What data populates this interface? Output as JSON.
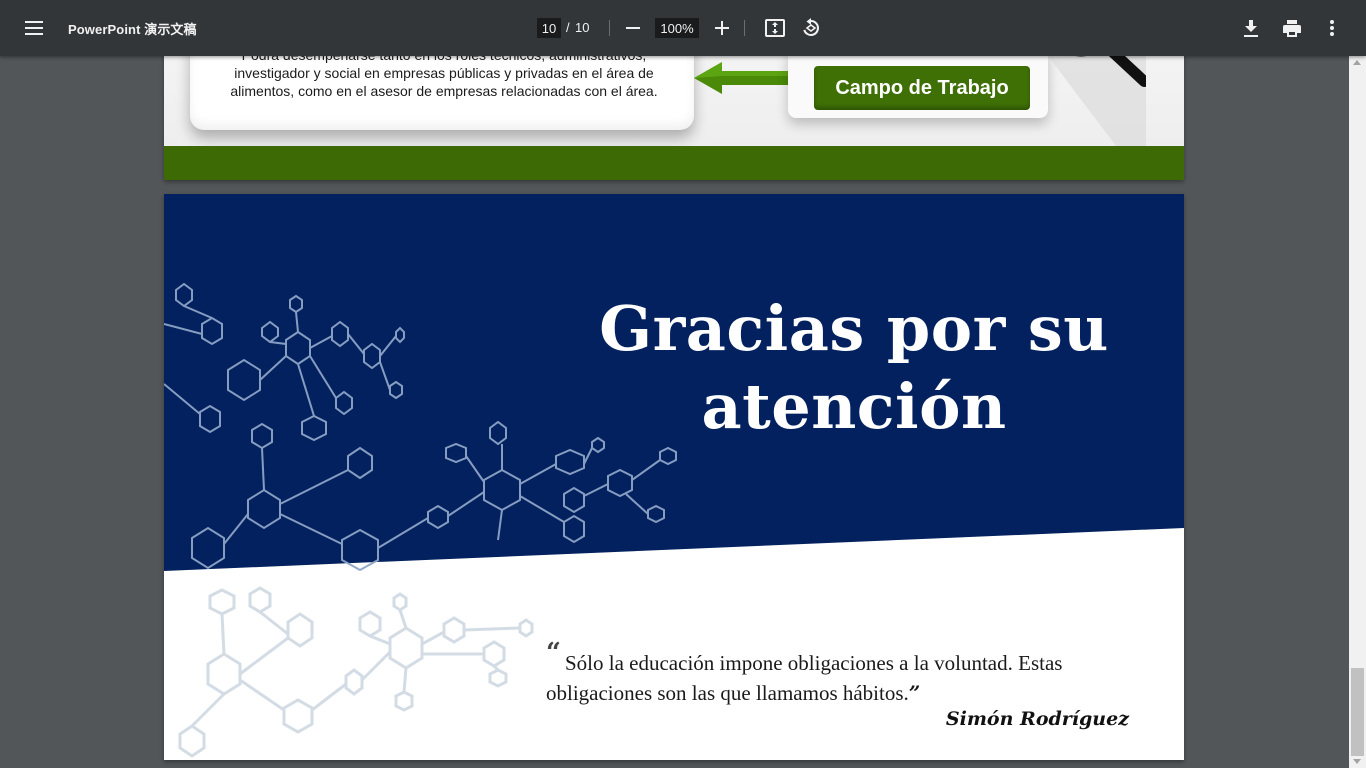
{
  "toolbar": {
    "title": "PowerPoint 演示文稿",
    "current_page": "10",
    "page_separator": "/",
    "total_pages": "10",
    "zoom": "100%",
    "icons": [
      "menu-icon",
      "zoom-out-icon",
      "zoom-in-icon",
      "fit-page-icon",
      "rotate-icon",
      "download-icon",
      "print-icon",
      "more-vert-icon"
    ]
  },
  "page9": {
    "description_text": "Podrá desempeñarse tanto en los roles técnicos, administrativos, investigador y social en empresas públicas y privadas en el área de alimentos, como en el asesor de empresas relacionadas con el área.",
    "button_label": "Campo de Trabajo",
    "colors": {
      "accent_green": "#3d6a04",
      "button_green": "#3f7006"
    }
  },
  "page10": {
    "title": "Gracias por su atención",
    "quote_open": "“",
    "quote": "Sólo la educación impone obligaciones a la voluntad. Estas obligaciones son las que llamamos hábitos.",
    "quote_close": "”",
    "author": "Simón Rodríguez",
    "colors": {
      "navy": "#03215e",
      "molecule_lines": "#8ea4c8",
      "molecule_faded": "#cfd9e2"
    }
  }
}
